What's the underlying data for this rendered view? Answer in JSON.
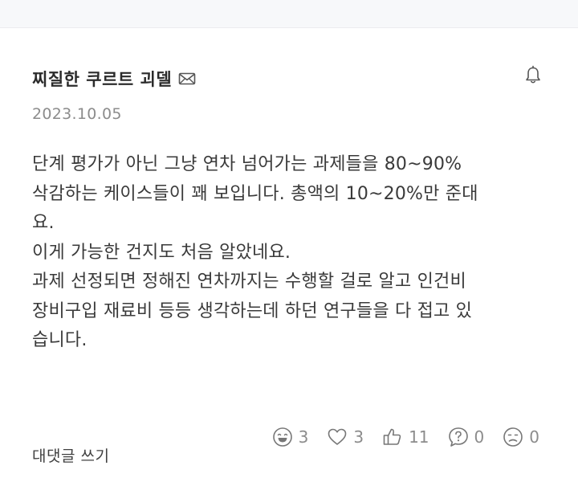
{
  "comment": {
    "author": "찌질한 쿠르트 괴델",
    "date": "2023.10.05",
    "body_lines": [
      "단계 평가가 아닌 그냥 연차 넘어가는 과제들을 80~90%",
      "삭감하는 케이스들이 꽤 보입니다. 총액의 10~20%만 준대",
      "요.",
      "이게 가능한 건지도 처음 알았네요.",
      "과제 선정되면 정해진 연차까지는 수행할 걸로 알고 인건비",
      "장비구입 재료비 등등 생각하는데 하던 연구들을 다 접고 있",
      "습니다."
    ],
    "reply_label": "대댓글 쓰기",
    "reactions": [
      {
        "icon": "laugh-face-icon",
        "count": "3"
      },
      {
        "icon": "heart-icon",
        "count": "3"
      },
      {
        "icon": "thumbs-up-icon",
        "count": "11"
      },
      {
        "icon": "question-icon",
        "count": "0"
      },
      {
        "icon": "sad-face-icon",
        "count": "0"
      }
    ]
  },
  "colors": {
    "text": "#3a3a3a",
    "muted": "#8c8c8c",
    "top_band": "#f7f8fa"
  }
}
